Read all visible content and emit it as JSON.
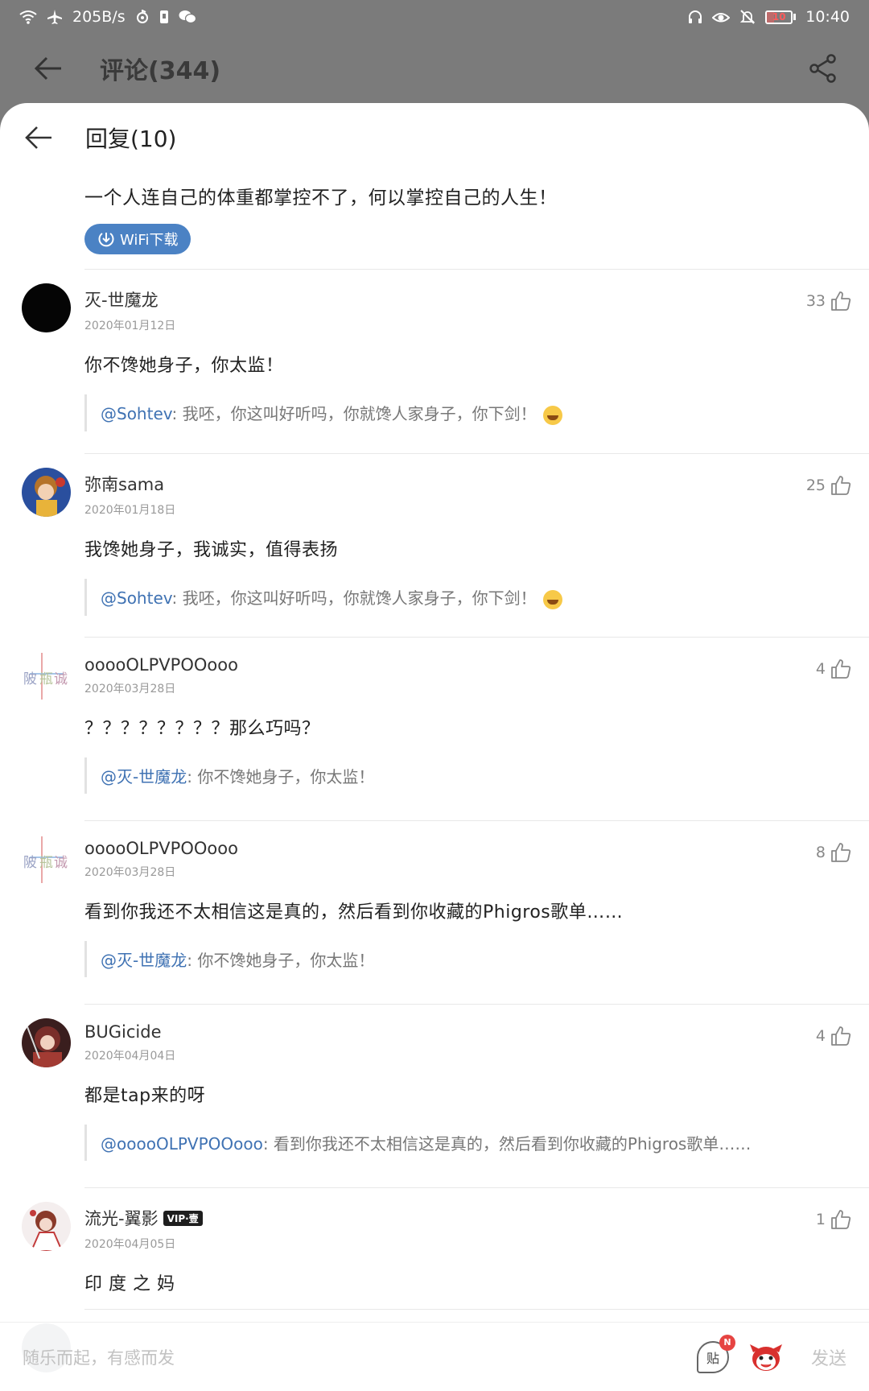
{
  "status_bar": {
    "net_speed": "205B/s",
    "battery": "10",
    "time": "10:40"
  },
  "app_bar": {
    "title": "评论(344)"
  },
  "sheet": {
    "title": "回复(10)",
    "main_comment": "一个人连自己的体重都掌控不了，何以掌控自己的人生！",
    "wifi_button": "WiFi下载"
  },
  "replies": [
    {
      "username": "灭-世魔龙",
      "date": "2020年01月12日",
      "likes": "33",
      "text": "你不馋她身子，你太监！",
      "quote_at": "@Sohtev",
      "quote_text": ": 我呸，你这叫好听吗，你就馋人家身子，你下剑！",
      "avatar": "black-circle-avatar"
    },
    {
      "username": "弥南sama",
      "date": "2020年01月18日",
      "likes": "25",
      "text": "我馋她身子，我诚实，值得表扬",
      "quote_at": "@Sohtev",
      "quote_text": ": 我呸，你这叫好听吗，你就馋人家身子，你下剑！",
      "avatar": "anime-girl-avatar"
    },
    {
      "username": "ooooOLPVPOOooo",
      "date": "2020年03月28日",
      "likes": "4",
      "text": "？？？？？？？？那么巧吗？",
      "quote_at": "@灭-世魔龙",
      "quote_text": ": 你不馋她身子，你太监！",
      "avatar": "calligraphy-avatar"
    },
    {
      "username": "ooooOLPVPOOooo",
      "date": "2020年03月28日",
      "likes": "8",
      "text": "看到你我还不太相信这是真的，然后看到你收藏的Phigros歌单……",
      "quote_at": "@灭-世魔龙",
      "quote_text": ": 你不馋她身子，你太监！",
      "avatar": "calligraphy-avatar"
    },
    {
      "username": "BUGicide",
      "date": "2020年04月04日",
      "likes": "4",
      "text": "都是tap来的呀",
      "quote_at": "@ooooOLPVPOOooo",
      "quote_text": ": 看到你我还不太相信这是真的，然后看到你收藏的Phigros歌单……",
      "avatar": "anime-girl-avatar"
    },
    {
      "username": "流光-翼影",
      "badge": "VIP·壹",
      "date": "2020年04月05日",
      "likes": "1",
      "text": "印 度 之 妈",
      "avatar": "anime-girl-avatar"
    }
  ],
  "input_bar": {
    "placeholder": "随乐而起，有感而发",
    "tie_label": "贴",
    "tie_badge": "N",
    "send": "发送"
  },
  "colors": {
    "link": "#3f72b3",
    "wifi_button_bg": "#4b82c4",
    "overlay": "#7b7b7b"
  }
}
